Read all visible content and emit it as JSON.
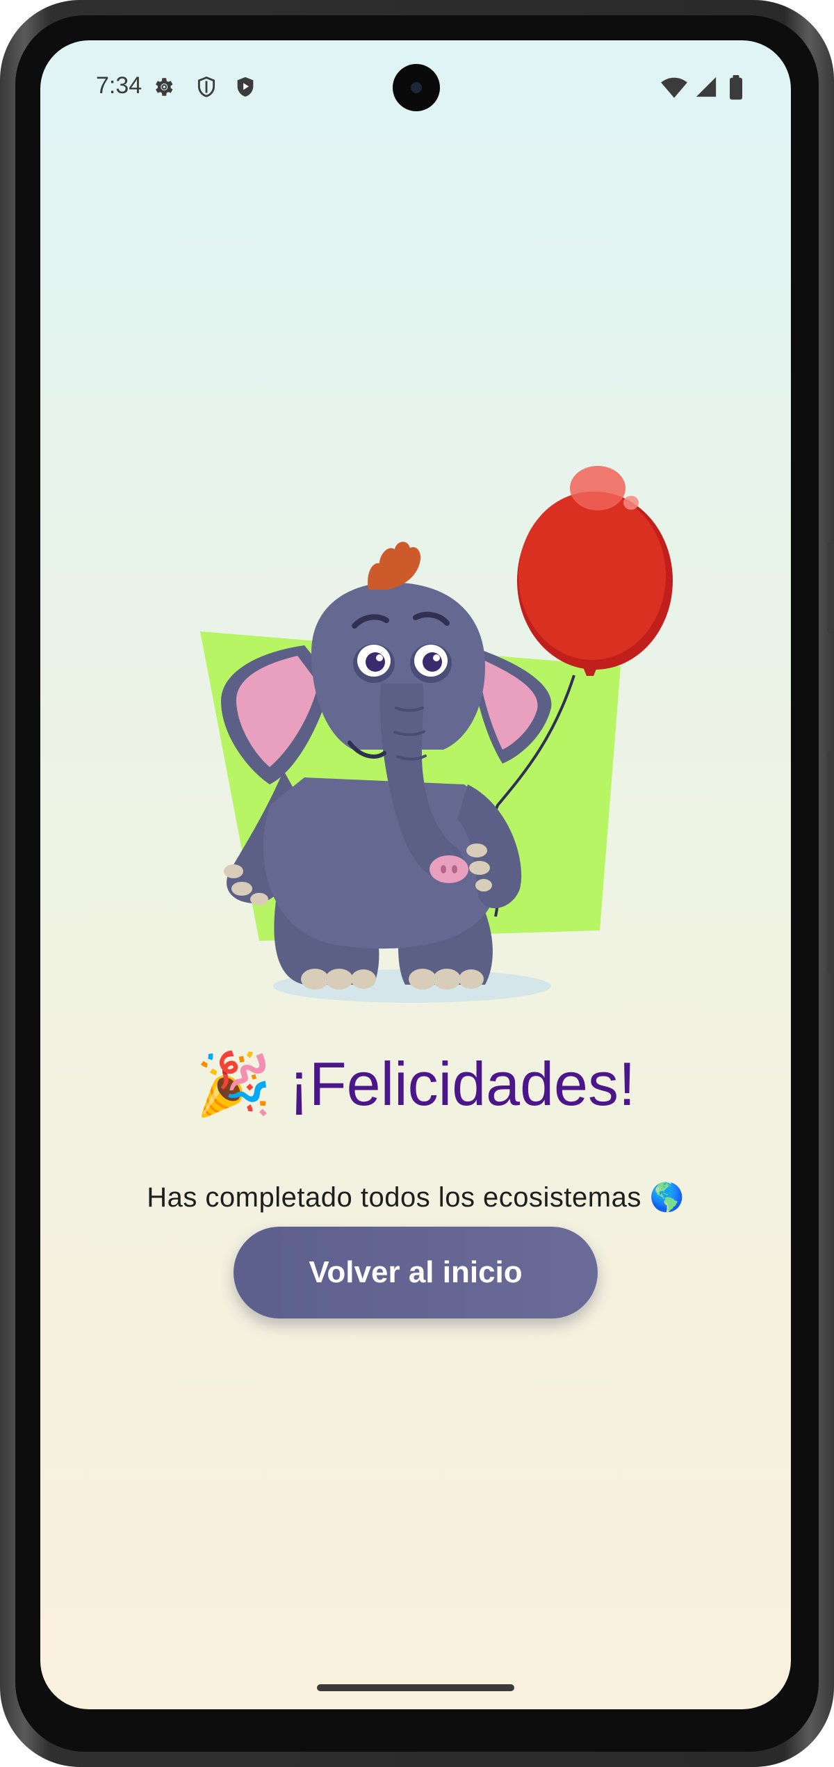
{
  "status_bar": {
    "time": "7:34",
    "left_icons": [
      "gear-icon",
      "shield-outline-icon",
      "shield-play-icon"
    ],
    "right_icons": [
      "wifi-icon",
      "cellular-signal-icon",
      "battery-icon"
    ]
  },
  "content": {
    "illustration": "elephant-with-balloon",
    "party_emoji": "🎉",
    "title": "¡Felicidades!",
    "subtitle_text": "Has completado todos los ecosistemas",
    "globe_emoji": "🌎",
    "button_label": "Volver al inicio"
  },
  "colors": {
    "title": "#4a168a",
    "button": "#62638f",
    "balloon": "#d93222",
    "elephant": "#656890",
    "backdrop": "#b7f565"
  }
}
